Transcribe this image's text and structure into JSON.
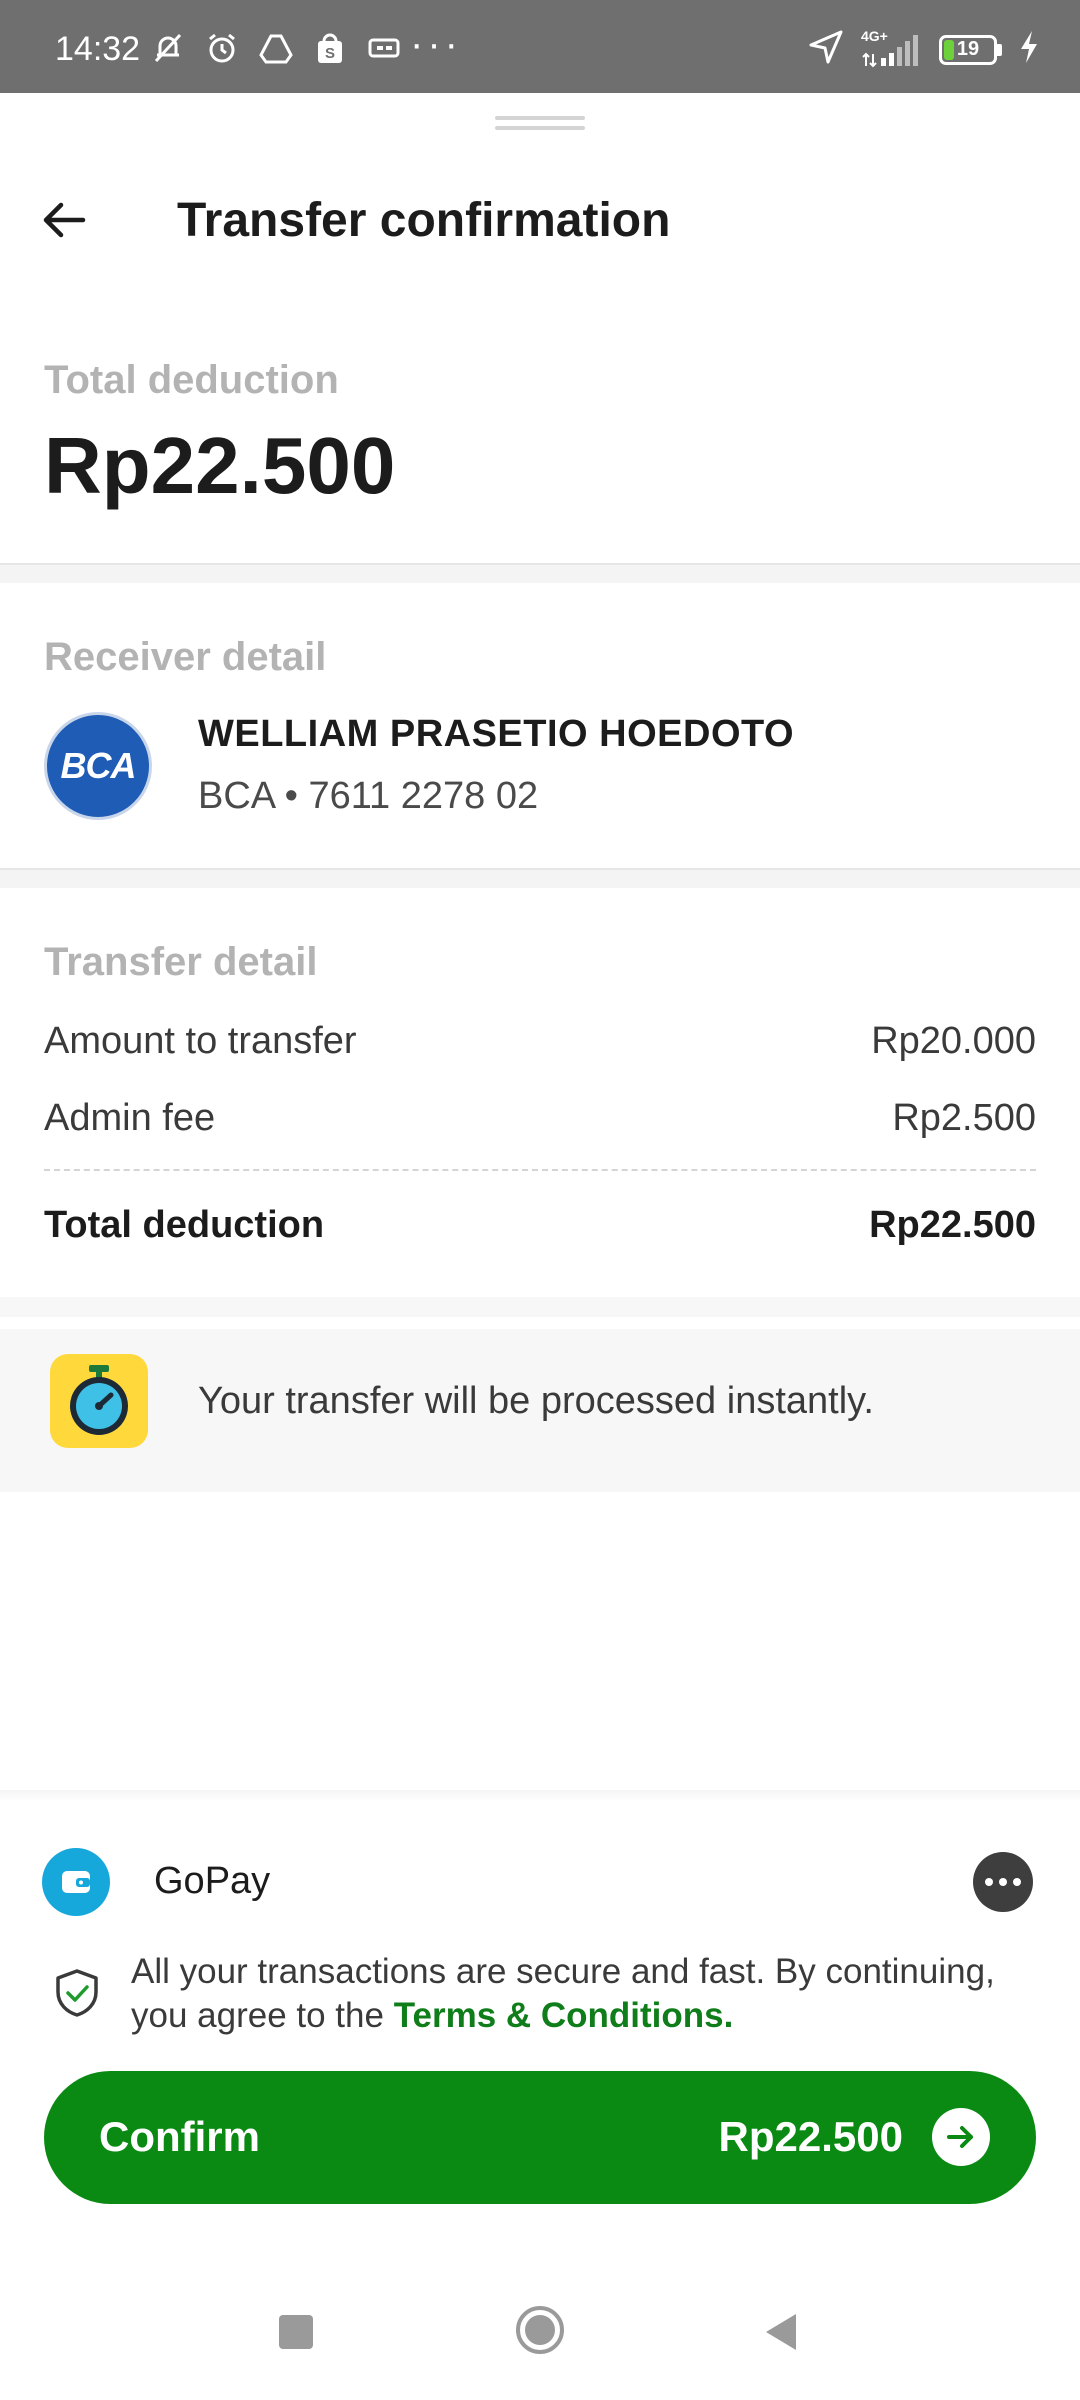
{
  "status_bar": {
    "time": "14:32",
    "left_icons": [
      "mute-bell-icon",
      "alarm-icon",
      "drive-icon",
      "shopping-bag-icon",
      "cast-icon"
    ],
    "overflow": "···",
    "network": "4G+",
    "battery_level": "19"
  },
  "header": {
    "back_icon": "arrow-left-icon",
    "title": "Transfer confirmation"
  },
  "total": {
    "label": "Total deduction",
    "amount": "Rp22.500"
  },
  "receiver": {
    "section_label": "Receiver detail",
    "bank_logo_text": "BCA",
    "name": "WELLIAM PRASETIO HOEDOTO",
    "account": "BCA • 7611 2278 02"
  },
  "transfer_detail": {
    "section_label": "Transfer detail",
    "rows": [
      {
        "label": "Amount to transfer",
        "value": "Rp20.000"
      },
      {
        "label": "Admin fee",
        "value": "Rp2.500"
      }
    ],
    "total_label": "Total deduction",
    "total_value": "Rp22.500"
  },
  "info": {
    "icon": "stopwatch-icon",
    "text": "Your transfer will be processed instantly."
  },
  "payment": {
    "method_icon": "wallet-icon",
    "method_name": "GoPay",
    "more_icon": "more-dots-icon",
    "secure_text": "All your transactions are secure and fast. By continuing, you agree to the ",
    "terms_link": "Terms & Conditions."
  },
  "confirm": {
    "label": "Confirm",
    "amount": "Rp22.500"
  },
  "colors": {
    "brand_green": "#0a8a13",
    "link_green": "#0f7d1a",
    "bca_blue": "#1f5cb5",
    "gopay_blue": "#16a8db",
    "timer_yellow": "#ffd93b"
  }
}
